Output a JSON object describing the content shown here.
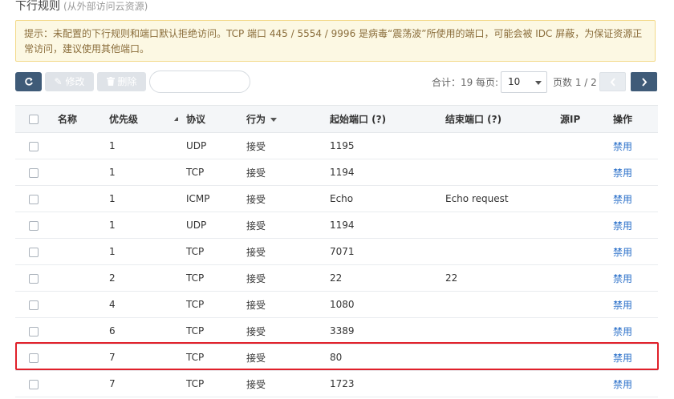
{
  "header": {
    "title": "下行规则",
    "subtitle": "(从外部访问云资源)"
  },
  "notice": {
    "text": "提示：未配置的下行规则和端口默认拒绝访问。TCP 端口 445 / 5554 / 9996 是病毒“震荡波”所使用的端口，可能会被 IDC 屏蔽，为保证资源正常访问，建议使用其他端口。"
  },
  "toolbar": {
    "edit_label": "修改",
    "delete_label": "删除",
    "search_value": "",
    "search_placeholder": "",
    "total_text": "合计：19",
    "per_page_label": "每页:",
    "per_page_value": "10",
    "page_text": "页数 1 / 2"
  },
  "table": {
    "columns": {
      "name": "名称",
      "priority": "优先级",
      "protocol": "协议",
      "action": "行为",
      "start_port": "起始端口 (?)",
      "end_port": "结束端口 (?)",
      "source_ip": "源IP",
      "operation": "操作"
    },
    "rows": [
      {
        "name": "",
        "priority": "1",
        "protocol": "UDP",
        "action": "接受",
        "start_port": "1195",
        "end_port": "",
        "source_ip": "",
        "op": "禁用"
      },
      {
        "name": "",
        "priority": "1",
        "protocol": "TCP",
        "action": "接受",
        "start_port": "1194",
        "end_port": "",
        "source_ip": "",
        "op": "禁用"
      },
      {
        "name": "",
        "priority": "1",
        "protocol": "ICMP",
        "action": "接受",
        "start_port": "Echo",
        "end_port": "Echo request",
        "source_ip": "",
        "op": "禁用"
      },
      {
        "name": "",
        "priority": "1",
        "protocol": "UDP",
        "action": "接受",
        "start_port": "1194",
        "end_port": "",
        "source_ip": "",
        "op": "禁用"
      },
      {
        "name": "",
        "priority": "1",
        "protocol": "TCP",
        "action": "接受",
        "start_port": "7071",
        "end_port": "",
        "source_ip": "",
        "op": "禁用"
      },
      {
        "name": "",
        "priority": "2",
        "protocol": "TCP",
        "action": "接受",
        "start_port": "22",
        "end_port": "22",
        "source_ip": "",
        "op": "禁用"
      },
      {
        "name": "",
        "priority": "4",
        "protocol": "TCP",
        "action": "接受",
        "start_port": "1080",
        "end_port": "",
        "source_ip": "",
        "op": "禁用"
      },
      {
        "name": "",
        "priority": "6",
        "protocol": "TCP",
        "action": "接受",
        "start_port": "3389",
        "end_port": "",
        "source_ip": "",
        "op": "禁用"
      },
      {
        "name": "",
        "priority": "7",
        "protocol": "TCP",
        "action": "接受",
        "start_port": "80",
        "end_port": "",
        "source_ip": "",
        "op": "禁用"
      },
      {
        "name": "",
        "priority": "7",
        "protocol": "TCP",
        "action": "接受",
        "start_port": "1723",
        "end_port": "",
        "source_ip": "",
        "op": "禁用"
      }
    ]
  },
  "colors": {
    "primary": "#3f5b78",
    "link": "#2a6fc9",
    "highlight": "#e0202a",
    "notice_bg": "#fcf8e3"
  }
}
